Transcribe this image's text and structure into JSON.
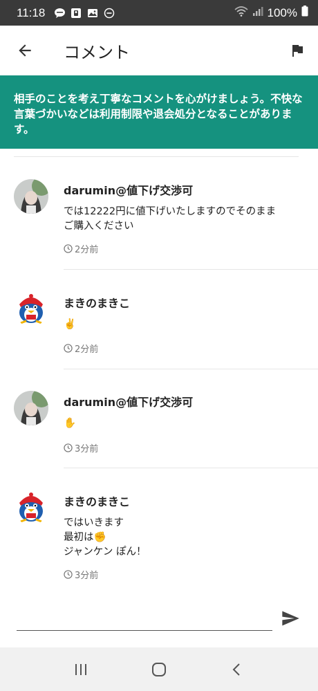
{
  "status_bar": {
    "time": "11:18",
    "battery": "100%"
  },
  "app_bar": {
    "title": "コメント"
  },
  "notice": {
    "text": "相手のことを考え丁寧なコメントを心がけましょう。不快な言葉づかいなどは利用制限や退会処分となることがあります。"
  },
  "comments": [
    {
      "name": "darumin@値下げ交渉可",
      "body": [
        "では12222円に値下げいたしますのでそのまま",
        "ご購入ください"
      ],
      "time": "2分前",
      "avatar": "person-photo"
    },
    {
      "name": "まきのまきこ",
      "body": [
        "✌️"
      ],
      "time": "2分前",
      "avatar": "penguin-mascot"
    },
    {
      "name": "darumin@値下げ交渉可",
      "body": [
        "✋"
      ],
      "time": "3分前",
      "avatar": "person-photo"
    },
    {
      "name": "まきのまきこ",
      "body": [
        "ではいきます",
        "最初は✊",
        "ジャンケン ぽん！"
      ],
      "time": "3分前",
      "avatar": "penguin-mascot"
    }
  ],
  "input": {
    "placeholder": "",
    "value": ""
  },
  "colors": {
    "status_bar": "#3a3a3a",
    "notice_bg": "#15927f",
    "nav_bar": "#f1f1f1"
  }
}
